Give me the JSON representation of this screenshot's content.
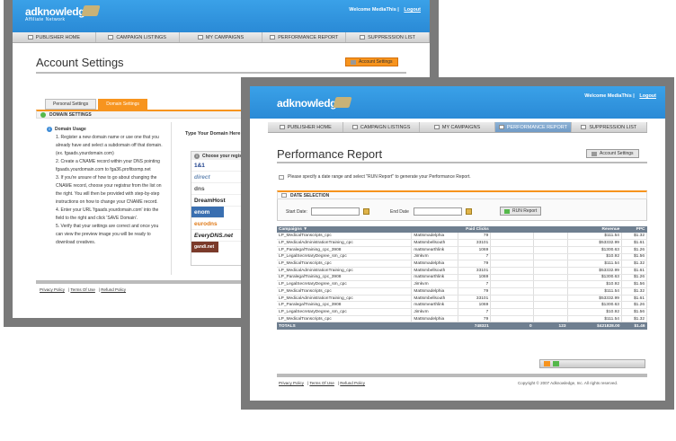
{
  "back": {
    "brand": "adknowledge",
    "brand_sub": "Affiliate Network",
    "welcome": "Welcome MediaThis",
    "logout": "Logout",
    "nav": [
      "PUBLISHER HOME",
      "CAMPAIGN LISTINGS",
      "MY CAMPAIGNS",
      "PERFORMANCE REPORT",
      "SUPPRESSION LIST"
    ],
    "title": "Account Settings",
    "account_button": "Account Settings",
    "tabs": [
      "Personal Settings",
      "Domain Settings"
    ],
    "section": "DOMAIN SETTINGS",
    "usage_title": "Domain Usage",
    "usage_lines": [
      "1. Register a new domain name or use one that you",
      "already have and select a subdomain off that domain.",
      "(ex. fgaads.yourdomain.com)",
      "2. Create a CNAME record within your DNS pointing",
      "fgaads.yourdomain.com to fga36.profitsxmp.net",
      "3. If you're unsure of how to go about changing the",
      "CNAME record, choose your registrar from the list on",
      "the right. You will then be provided with step-by-step",
      "instructions on how to change your CNAME record.",
      "4. Enter your URL 'fgaads.yourdomain.com' into the",
      "field to the right and click 'SAVE Domain'.",
      "5. Verify that your settings are correct and once you",
      "can view the preview image you will be ready to",
      "download creatives."
    ],
    "type_domain": "Type Your Domain Here",
    "registrar_head": "Choose your registr",
    "registrars": [
      "1&1",
      "direct",
      "dns",
      "DreamHost",
      "enom",
      "eurodns",
      "EveryDNS.net",
      "gandi.net"
    ],
    "footer": [
      "Privacy Policy",
      "Terms Of Use",
      "Refund Policy"
    ]
  },
  "front": {
    "brand": "adknowledge",
    "welcome": "Welcome MediaThis",
    "logout": "Logout",
    "nav": [
      "PUBLISHER HOME",
      "CAMPAIGN LISTINGS",
      "MY CAMPAIGNS",
      "PERFORMANCE REPORT",
      "SUPPRESSION LIST"
    ],
    "active_nav": 3,
    "title": "Performance Report",
    "account_button": "Account Settings",
    "instruction": "Please specify a date range and select \"RUN Report\" to generate your Performance Report.",
    "date_section": "DATE SELECTION",
    "start_label": "Start Date:",
    "end_label": "End Date",
    "run_label": "RUN Report",
    "columns": [
      "Campaigns",
      "",
      "Paid Clicks",
      "",
      "",
      "Revenue",
      "PPC"
    ],
    "rows": [
      [
        "LP_MedicalTranscripts_cpc",
        "Mattsmadelphia",
        "79",
        "",
        "",
        "$111.54",
        "$1.32"
      ],
      [
        "LP_MedicalAdministrationTraining_cpc",
        "Mattsmbellsouth",
        "33101",
        "",
        "",
        "$53332.99",
        "$1.61"
      ],
      [
        "LP_ParalegalTraining_cpc_3908",
        "mattsmearthlink",
        "1069",
        "",
        "",
        "$1300.63",
        "$1.26"
      ],
      [
        "LP_LegalSecretaryDegree_sm_cpc",
        "Jimkvm",
        "7",
        "",
        "",
        "$10.92",
        "$1.56"
      ],
      [
        "LP_MedicalTranscripts_cpc",
        "Mattsmadelphia",
        "79",
        "",
        "",
        "$111.54",
        "$1.32"
      ],
      [
        "LP_MedicalAdministrationTraining_cpc",
        "Mattsmbellsouth",
        "33101",
        "",
        "",
        "$53332.99",
        "$1.61"
      ],
      [
        "LP_ParalegalTraining_cpc_3908",
        "mattsmearthlink",
        "1069",
        "",
        "",
        "$1300.63",
        "$1.26"
      ],
      [
        "LP_LegalSecretaryDegree_sm_cpc",
        "Jimkvm",
        "7",
        "",
        "",
        "$10.92",
        "$1.56"
      ],
      [
        "LP_MedicalTranscripts_cpc",
        "Mattsmadelphia",
        "79",
        "",
        "",
        "$111.54",
        "$1.32"
      ],
      [
        "LP_MedicalAdministrationTraining_cpc",
        "Mattsmbellsouth",
        "33101",
        "",
        "",
        "$53332.99",
        "$1.61"
      ],
      [
        "LP_ParalegalTraining_cpc_3908",
        "mattsmearthlink",
        "1069",
        "",
        "",
        "$1300.63",
        "$1.26"
      ],
      [
        "LP_LegalSecretaryDegree_sm_cpc",
        "Jimkvm",
        "7",
        "",
        "",
        "$10.92",
        "$1.56"
      ],
      [
        "LP_MedicalTranscripts_cpc",
        "Mattsmadelphia",
        "79",
        "",
        "",
        "$111.54",
        "$1.32"
      ]
    ],
    "totals": [
      "TOTALS",
      "",
      "748321",
      "0",
      "123",
      "$421828.00",
      "$1.46"
    ],
    "footer": [
      "Privacy Policy",
      "Terms Of Use",
      "Refund Policy"
    ],
    "copyright": "Copyright © 2007 Adknowledge, Inc. All rights reserved.",
    "colors": {
      "banner": "#3aa1e8",
      "accent": "#f7941e",
      "table_head": "#6f7f90"
    }
  }
}
